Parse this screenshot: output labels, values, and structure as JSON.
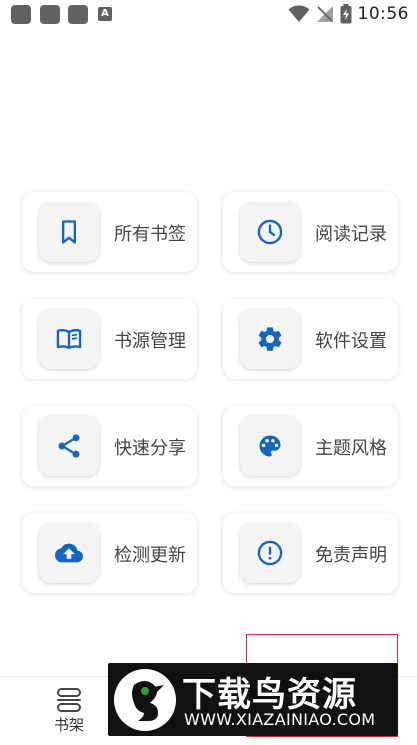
{
  "status_bar": {
    "time": "10:56",
    "a_badge": "A"
  },
  "menu": {
    "items": [
      {
        "label": "所有书签",
        "icon": "bookmark-icon"
      },
      {
        "label": "阅读记录",
        "icon": "clock-icon"
      },
      {
        "label": "书源管理",
        "icon": "book-open-icon"
      },
      {
        "label": "软件设置",
        "icon": "gear-icon"
      },
      {
        "label": "快速分享",
        "icon": "share-icon"
      },
      {
        "label": "主题风格",
        "icon": "palette-icon"
      },
      {
        "label": "检测更新",
        "icon": "cloud-upload-icon"
      },
      {
        "label": "免责声明",
        "icon": "alert-circle-icon"
      }
    ],
    "icon_color": "#1565c0"
  },
  "bottom_nav": {
    "items": [
      {
        "label": "书架",
        "icon": "bookshelf-icon"
      }
    ]
  },
  "watermark": {
    "title": "下载鸟资源",
    "url": "WWW.XIAZAINIAO.COM"
  }
}
